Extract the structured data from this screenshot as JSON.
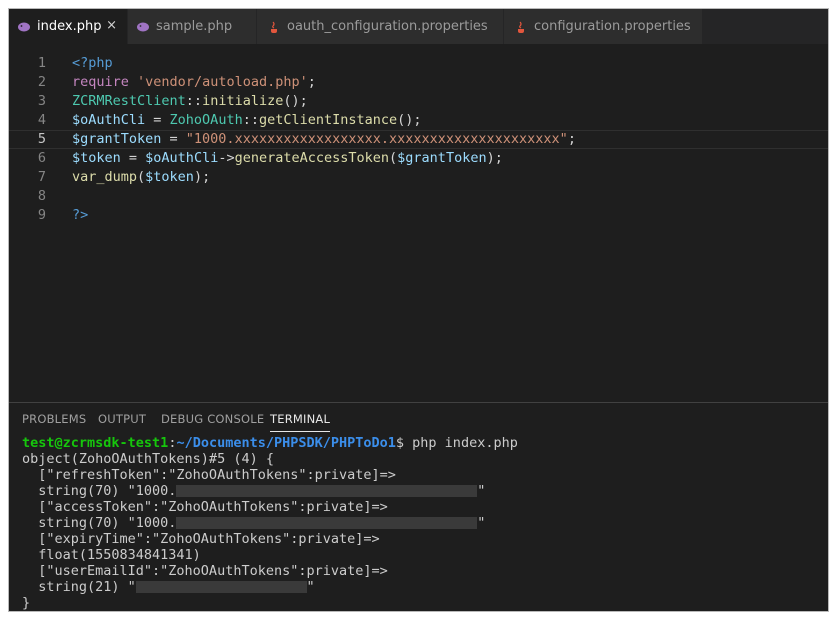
{
  "tabs": [
    {
      "label": "index.php",
      "icon": "php-elephant-icon",
      "active": true,
      "close": "×"
    },
    {
      "label": "sample.php",
      "icon": "php-elephant-icon",
      "active": false
    },
    {
      "label": "oauth_configuration.properties",
      "icon": "java-icon",
      "active": false
    },
    {
      "label": "configuration.properties",
      "icon": "java-icon",
      "active": false
    }
  ],
  "editor": {
    "current_line": 5,
    "lines": [
      {
        "n": "1",
        "tokens": [
          {
            "t": "<?php",
            "c": "k-tag"
          }
        ]
      },
      {
        "n": "2",
        "tokens": [
          {
            "t": "require",
            "c": "k-ctrl"
          },
          {
            "t": " ",
            "c": "k-op"
          },
          {
            "t": "'vendor/autoload.php'",
            "c": "k-str"
          },
          {
            "t": ";",
            "c": "k-op"
          }
        ]
      },
      {
        "n": "3",
        "tokens": [
          {
            "t": "ZCRMRestClient",
            "c": "k-cls"
          },
          {
            "t": "::",
            "c": "k-op"
          },
          {
            "t": "initialize",
            "c": "k-fn"
          },
          {
            "t": "();",
            "c": "k-op"
          }
        ]
      },
      {
        "n": "4",
        "tokens": [
          {
            "t": "$oAuthCli",
            "c": "k-var"
          },
          {
            "t": " = ",
            "c": "k-op"
          },
          {
            "t": "ZohoOAuth",
            "c": "k-cls"
          },
          {
            "t": "::",
            "c": "k-op"
          },
          {
            "t": "getClientInstance",
            "c": "k-fn"
          },
          {
            "t": "();",
            "c": "k-op"
          }
        ]
      },
      {
        "n": "5",
        "tokens": [
          {
            "t": "$grantToken",
            "c": "k-var"
          },
          {
            "t": " = ",
            "c": "k-op"
          },
          {
            "t": "\"1000.xxxxxxxxxxxxxxxxxx.xxxxxxxxxxxxxxxxxxxxx\"",
            "c": "k-str"
          },
          {
            "t": ";",
            "c": "k-op"
          }
        ]
      },
      {
        "n": "6",
        "tokens": [
          {
            "t": "$token",
            "c": "k-var"
          },
          {
            "t": " = ",
            "c": "k-op"
          },
          {
            "t": "$oAuthCli",
            "c": "k-var"
          },
          {
            "t": "->",
            "c": "k-op"
          },
          {
            "t": "generateAccessToken",
            "c": "k-fn"
          },
          {
            "t": "(",
            "c": "k-op"
          },
          {
            "t": "$grantToken",
            "c": "k-var"
          },
          {
            "t": ");",
            "c": "k-op"
          }
        ]
      },
      {
        "n": "7",
        "tokens": [
          {
            "t": "var_dump",
            "c": "k-fn"
          },
          {
            "t": "(",
            "c": "k-op"
          },
          {
            "t": "$token",
            "c": "k-var"
          },
          {
            "t": ");",
            "c": "k-op"
          }
        ]
      },
      {
        "n": "8",
        "tokens": []
      },
      {
        "n": "9",
        "tokens": [
          {
            "t": "?>",
            "c": "k-tag"
          }
        ]
      }
    ]
  },
  "panel": {
    "tabs": [
      "PROBLEMS",
      "OUTPUT",
      "DEBUG CONSOLE",
      "TERMINAL"
    ],
    "active_tab": "TERMINAL"
  },
  "terminal": {
    "prompt_user": "test@zcrmsdk-test1",
    "prompt_sep": ":",
    "prompt_path": "~/Documents/PHPSDK/PHPToDo1",
    "prompt_symbol": "$ ",
    "command": "php index.php",
    "lines": [
      {
        "text": "object(ZohoOAuthTokens)#5 (4) {"
      },
      {
        "text": "  [\"refreshToken\":\"ZohoOAuthTokens\":private]=>"
      },
      {
        "text": "  string(70) \"1000.",
        "redact_ch": 37,
        "tail": "\""
      },
      {
        "text": "  [\"accessToken\":\"ZohoOAuthTokens\":private]=>"
      },
      {
        "text": "  string(70) \"1000.",
        "redact_ch": 37,
        "tail": "\""
      },
      {
        "text": "  [\"expiryTime\":\"ZohoOAuthTokens\":private]=>"
      },
      {
        "text": "  float(1550834841341)"
      },
      {
        "text": "  [\"userEmailId\":\"ZohoOAuthTokens\":private]=>"
      },
      {
        "text": "  string(21) \"",
        "redact_ch": 21,
        "tail": "\""
      },
      {
        "text": "}"
      }
    ]
  },
  "colors": {
    "editor_bg": "#1e1e1e",
    "tab_bar_bg": "#252526",
    "prompt_user": "#16c60c",
    "prompt_path": "#3b8eea"
  }
}
